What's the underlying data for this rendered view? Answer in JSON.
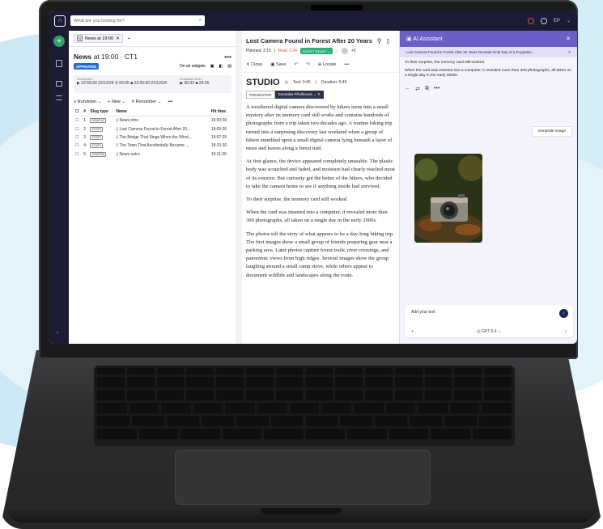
{
  "app": {
    "search_placeholder": "What are you looking for?",
    "user_initials": "EP"
  },
  "left": {
    "tab_label": "News at 19:00",
    "title": "News",
    "title_time": "at 19:00",
    "title_channel": "· CT1",
    "approved": "APPROVED",
    "on_air": "On air widgets",
    "scheduled_label": "Scheduled",
    "scheduled_value": "▶ 22:55:00 22/12/24",
    "scheduled_dur": "⏱ 00:05",
    "scheduled_end": "■ 22:55:00 22/12/24",
    "backtimer_label": "Rundown timer",
    "backtimer_a": "▶ 00:32",
    "backtimer_b": "■ 29:26",
    "rundown_btn": "Rundown",
    "new_btn": "New",
    "renumber_btn": "Renumber",
    "columns": [
      "#",
      "Slug type",
      "Name",
      "Hit time"
    ],
    "rows": [
      {
        "n": "1",
        "slug": "GRAPHIC",
        "name": "News intro",
        "hit": "19:00:00"
      },
      {
        "n": "2",
        "slug": "STORY",
        "name": "Lost Camera Found in Forest After 20...",
        "hit": "19:05:00"
      },
      {
        "n": "3",
        "slug": "STORY",
        "name": "The Bridge That Sings When the Wind...",
        "hit": "19:07:25"
      },
      {
        "n": "4",
        "slug": "STORY",
        "name": "The Town That Accidentally Became ...",
        "hit": "19:10:30"
      },
      {
        "n": "5",
        "slug": "GRAPHIC",
        "name": "News outro",
        "hit": "19:11:00"
      }
    ]
  },
  "editor": {
    "title": "Lost Camera Found in Forest After 20 Years",
    "planned": "Planned: 2:15",
    "real": "Real: 2:24",
    "script_ready": "SCRIPT READY",
    "avatar_count": "+5",
    "close": "Close",
    "save": "Save",
    "locate": "Locate",
    "studio": "STUDIO",
    "text_time": "Text: 0:45",
    "duration": "Duration: 0:45",
    "presenter": "PRESENTER",
    "presenter_name": "Dominika Přívětivová",
    "paragraphs": [
      "A weathered digital camera discovered by hikers turns into a small mystery after its memory card still works and contains hundreds of photographs from a trip taken two decades ago. A routine hiking trip turned into a surprising discovery last weekend when a group of hikers stumbled upon a small digital camera lying beneath a layer of moss and leaves along a forest trail.",
      "At first glance, the device appeared completely unusable. The plastic body was scratched and faded, and moisture had clearly reached most of its exterior. But curiosity got the better of the hikers, who decided to take the camera home to see if anything inside had survived.",
      "To their surprise, the memory card still worked.",
      "When the card was inserted into a computer, it revealed more than 300 photographs, all taken on a single day in the early 2000s.",
      "The photos tell the story of what appears to be a day-long biking trip. The first images show a small group of friends preparing gear near a parking area. Later photos capture forest trails, river crossings, and panoramic views from high ridges. Several images show the group laughing around a small camp stove, while others appear to document wildlife and landscapes along the route."
    ]
  },
  "ai": {
    "title": "AI Asisstant",
    "thread": "Lost Camera Found in Forest After 20 Years Reveals Final Day of a Forgotten...",
    "msg1": "To their surprise, the memory card still worked.",
    "msg2": "When the card was inserted into a computer, it revealed more than 300 photographs, all taken on a single day in the early 2000s.",
    "generate": "Generate image",
    "input_placeholder": "Add your text",
    "model": "GPT-5.4"
  }
}
